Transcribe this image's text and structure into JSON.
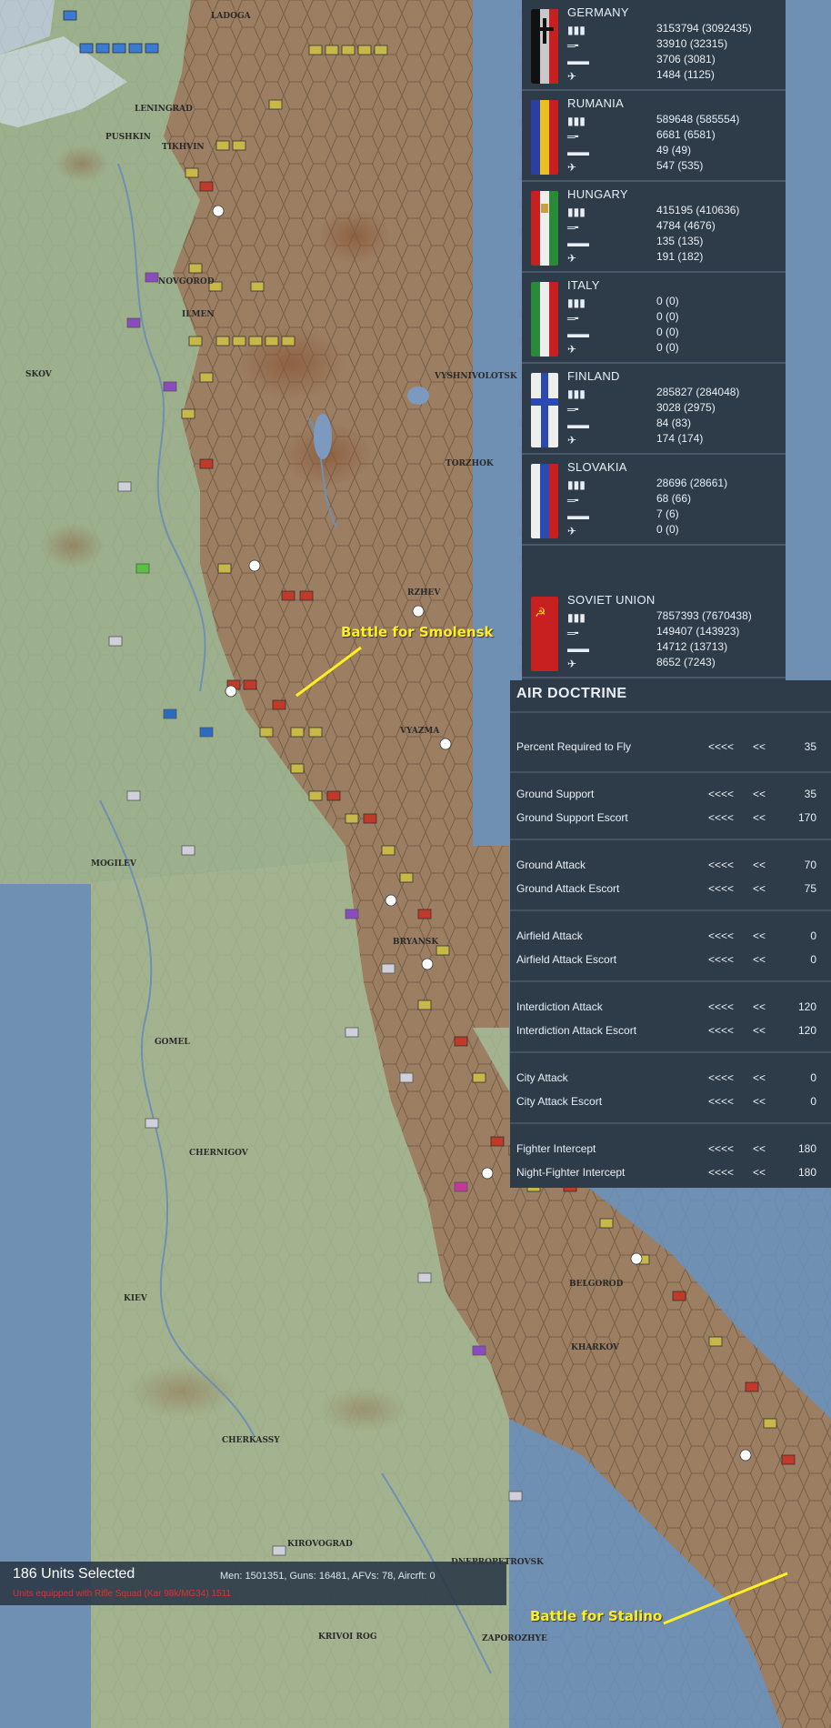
{
  "colors": {
    "sea": "#6f8fb3",
    "land": "#9db08d",
    "enemy": "#9c7e63",
    "panel": "#2e3c4a",
    "panel_text": "#e8eef4",
    "battle": "#ffee22"
  },
  "map": {
    "cities": [
      "LENINGRAD",
      "SKOV",
      "ILMEN",
      "VYSHNIVOLOTSK",
      "TORZHOK",
      "RZHEV",
      "VYAZMA",
      "MOGILEV",
      "BRYANSK",
      "GOMEL",
      "CHERNIGOV",
      "KIEV",
      "BELGOROD",
      "KHARKOV",
      "DNEPROPETROVSK",
      "ZAPOROZHYE",
      "KRIVOI ROG",
      "CHERKASSY",
      "KIROVOGRAD",
      "LADOGA",
      "PUSHKIN",
      "TIKHVIN",
      "NOVGOROD"
    ],
    "battles": [
      {
        "label": "Battle for Smolensk"
      },
      {
        "label": "Battle for Stalino"
      }
    ]
  },
  "nations": [
    {
      "name": "GERMANY",
      "flag": "germany-flag",
      "men": "3153794 (3092435)",
      "guns": "33910 (32315)",
      "afvs": "3706 (3081)",
      "aircraft": "1484 (1125)"
    },
    {
      "name": "RUMANIA",
      "flag": "rumania-flag",
      "men": "589648 (585554)",
      "guns": "6681 (6581)",
      "afvs": "49 (49)",
      "aircraft": "547 (535)"
    },
    {
      "name": "HUNGARY",
      "flag": "hungary-flag",
      "men": "415195 (410636)",
      "guns": "4784 (4676)",
      "afvs": "135 (135)",
      "aircraft": "191 (182)"
    },
    {
      "name": "ITALY",
      "flag": "italy-flag",
      "men": "0 (0)",
      "guns": "0 (0)",
      "afvs": "0 (0)",
      "aircraft": "0 (0)"
    },
    {
      "name": "FINLAND",
      "flag": "finland-flag",
      "men": "285827 (284048)",
      "guns": "3028 (2975)",
      "afvs": "84 (83)",
      "aircraft": "174 (174)"
    },
    {
      "name": "SLOVAKIA",
      "flag": "slovakia-flag",
      "men": "28696 (28661)",
      "guns": "68 (66)",
      "afvs": "7 (6)",
      "aircraft": "0 (0)"
    },
    {
      "name": "SOVIET UNION",
      "flag": "soviet-flag",
      "men": "7857393 (7670438)",
      "guns": "149407 (143923)",
      "afvs": "14712 (13713)",
      "aircraft": "8652 (7243)"
    }
  ],
  "air_doctrine": {
    "title": "AIR DOCTRINE",
    "dec4": "<<<<",
    "dec2": "<<",
    "rows": [
      {
        "label": "Percent Required to Fly",
        "value": "35"
      },
      {
        "label": "Ground Support",
        "value": "35"
      },
      {
        "label": "Ground Support Escort",
        "value": "170"
      },
      {
        "label": "Ground Attack",
        "value": "70"
      },
      {
        "label": "Ground Attack Escort",
        "value": "75"
      },
      {
        "label": "Airfield Attack",
        "value": "0"
      },
      {
        "label": "Airfield Attack Escort",
        "value": "0"
      },
      {
        "label": "Interdiction Attack",
        "value": "120"
      },
      {
        "label": "Interdiction Attack Escort",
        "value": "120"
      },
      {
        "label": "City Attack",
        "value": "0"
      },
      {
        "label": "City Attack Escort",
        "value": "0"
      },
      {
        "label": "Fighter Intercept",
        "value": "180"
      },
      {
        "label": "Night-Fighter Intercept",
        "value": "180"
      }
    ]
  },
  "selection": {
    "count_label": "186 Units Selected",
    "stats": "Men: 1501351, Guns: 16481, AFVs: 78, Aircrft: 0",
    "warning": "Units equipped with Rifle Squad (Kar 98k/MG34) 1511"
  }
}
